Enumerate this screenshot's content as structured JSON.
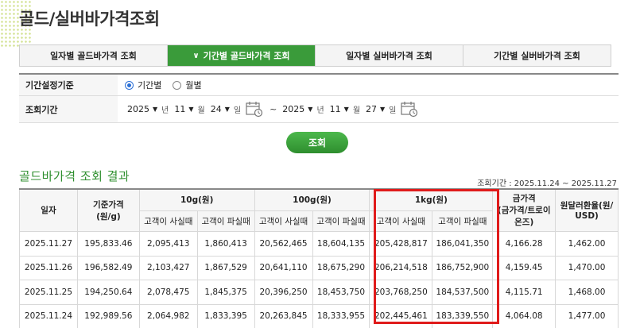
{
  "page": {
    "title": "골드/실버바가격조회"
  },
  "tabs": [
    {
      "label": "일자별 골드바가격 조회",
      "active": false
    },
    {
      "label": "기간별 골드바가격 조회",
      "active": true
    },
    {
      "label": "일자별 실버바가격 조회",
      "active": false
    },
    {
      "label": "기간별 실버바가격 조회",
      "active": false
    }
  ],
  "search": {
    "basis_label": "기간설정기준",
    "basis_options": [
      "기간별",
      "월별"
    ],
    "basis_selected": "기간별",
    "period_label": "조회기간",
    "from": {
      "year": "2025",
      "month": "11",
      "day": "24"
    },
    "to": {
      "year": "2025",
      "month": "11",
      "day": "27"
    },
    "unit_year": "년",
    "unit_month": "월",
    "unit_day": "일",
    "tilde": "~",
    "search_button": "조회"
  },
  "result": {
    "title": "골드바가격 조회 결과",
    "period_text": "조회기간 : 2025.11.24 ~ 2025.11.27",
    "headers": {
      "date": "일자",
      "base_price": "기준가격\n(원/g)",
      "g10": "10g(원)",
      "g100": "100g(원)",
      "kg1": "1kg(원)",
      "gold_price": "금가격\n(금가격/트로이\n온즈)",
      "usd_rate": "원달러환율(원/\nUSD)",
      "buy": "고객이 사실때",
      "sell": "고객이 파실때"
    },
    "rows": [
      {
        "date": "2025.11.27",
        "base": "195,833.46",
        "g10_buy": "2,095,413",
        "g10_sell": "1,860,413",
        "g100_buy": "20,562,465",
        "g100_sell": "18,604,135",
        "kg_buy": "205,428,817",
        "kg_sell": "186,041,350",
        "gold": "4,166.28",
        "usd": "1,462.00"
      },
      {
        "date": "2025.11.26",
        "base": "196,582.49",
        "g10_buy": "2,103,427",
        "g10_sell": "1,867,529",
        "g100_buy": "20,641,110",
        "g100_sell": "18,675,290",
        "kg_buy": "206,214,518",
        "kg_sell": "186,752,900",
        "gold": "4,159.45",
        "usd": "1,470.00"
      },
      {
        "date": "2025.11.25",
        "base": "194,250.64",
        "g10_buy": "2,078,475",
        "g10_sell": "1,845,375",
        "g100_buy": "20,396,250",
        "g100_sell": "18,453,750",
        "kg_buy": "203,768,250",
        "kg_sell": "184,537,500",
        "gold": "4,115.71",
        "usd": "1,468.00"
      },
      {
        "date": "2025.11.24",
        "base": "192,989.56",
        "g10_buy": "2,064,982",
        "g10_sell": "1,833,395",
        "g100_buy": "20,263,845",
        "g100_sell": "18,333,955",
        "kg_buy": "202,445,461",
        "kg_sell": "183,339,550",
        "gold": "4,064.08",
        "usd": "1,477.00"
      }
    ]
  },
  "colors": {
    "accent_green": "#3a9b3a",
    "highlight_red": "#e01b1b",
    "radio_blue": "#2b6fd6"
  },
  "icons": {
    "calendar": "calendar-icon",
    "chevron": "chevron-down-icon"
  }
}
